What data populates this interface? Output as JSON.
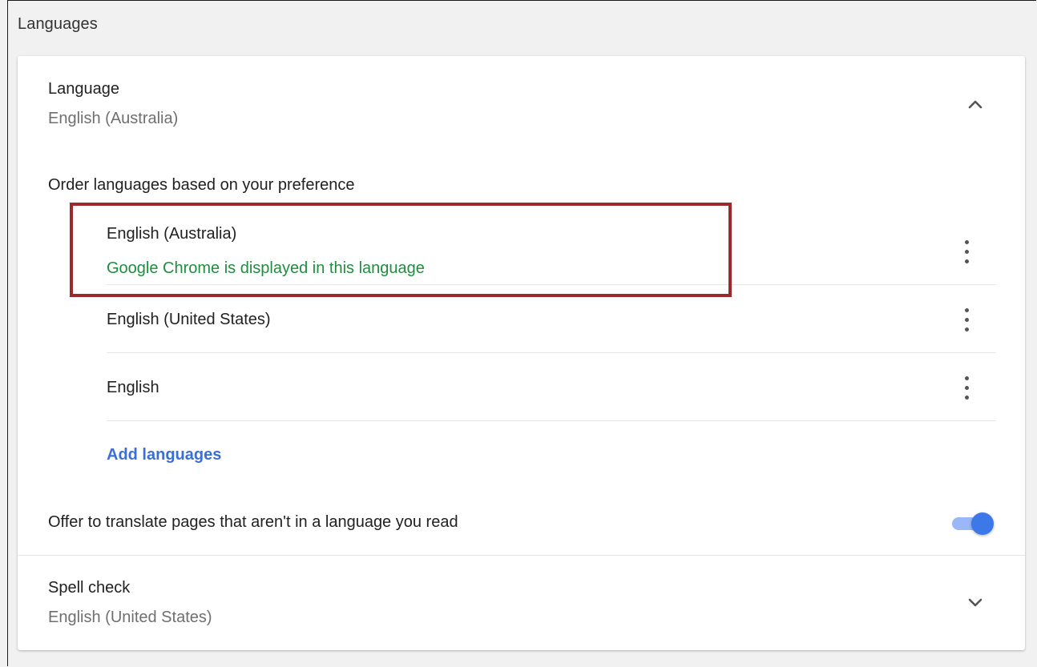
{
  "section": {
    "header": "Languages"
  },
  "language_row": {
    "title": "Language",
    "value": "English (Australia)"
  },
  "order_label": "Order languages based on your preference",
  "languages": [
    {
      "name": "English (Australia)",
      "note": "Google Chrome is displayed in this language"
    },
    {
      "name": "English (United States)"
    },
    {
      "name": "English"
    }
  ],
  "add_languages": "Add languages",
  "translate": {
    "label": "Offer to translate pages that aren't in a language you read",
    "enabled": true
  },
  "spell_check": {
    "title": "Spell check",
    "value": "English (United States)"
  },
  "colors": {
    "accent": "#3c78e8",
    "link": "#3b6fd6",
    "note": "#1e8e3e",
    "highlight": "#9c2a2a"
  },
  "icons": {
    "expand_open": "chevron-up-icon",
    "expand_closed": "chevron-down-icon",
    "more": "more-vert-icon"
  }
}
